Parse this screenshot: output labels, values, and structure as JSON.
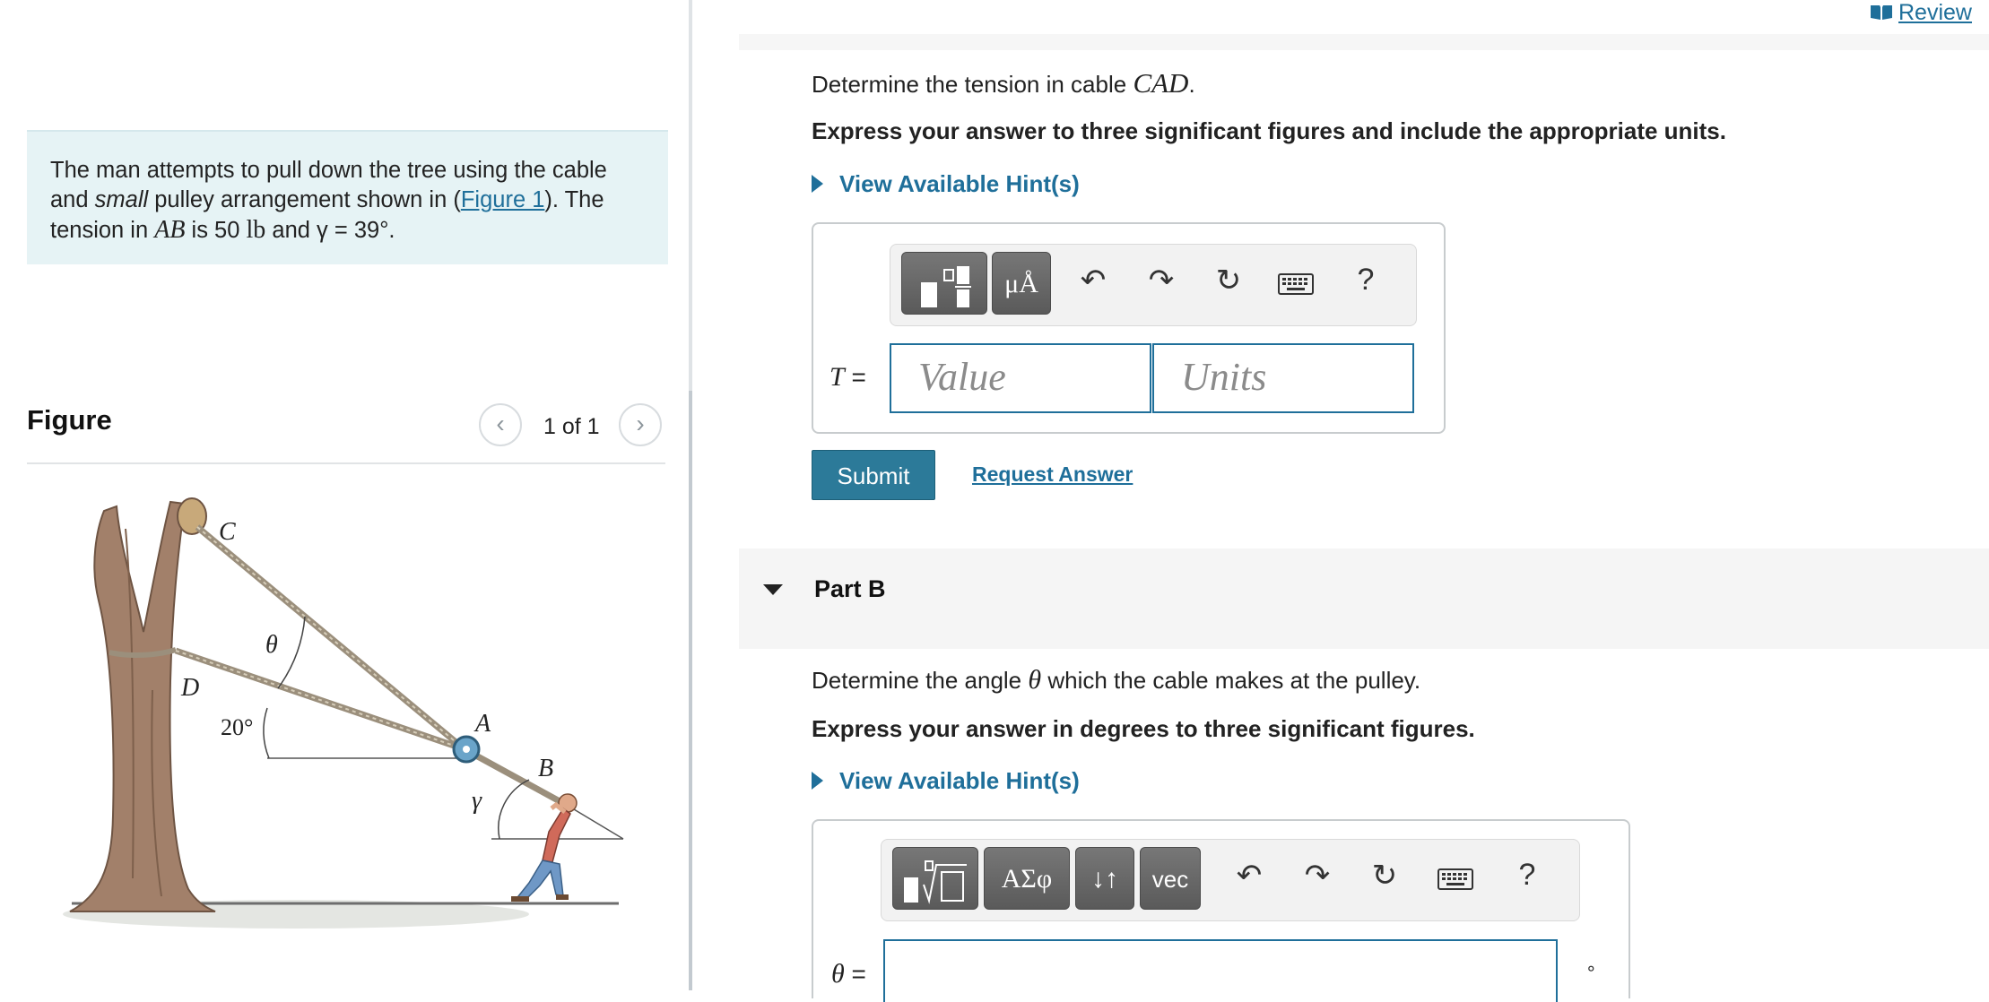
{
  "intro": {
    "t1": "The man attempts to pull down the tree using the cable and ",
    "t2": "small",
    "t3": " pulley arrangement shown in (",
    "link": "Figure 1",
    "t4": "). The tension in ",
    "ab": "AB",
    "t5": " is 50 ",
    "lb": "lb",
    "t6": " and ",
    "gamma": "γ = 39°."
  },
  "figure": {
    "title": "Figure",
    "pager": "1 of 1",
    "prev_icon": "chevron-left-icon",
    "next_icon": "chevron-right-icon",
    "labels": {
      "C": "C",
      "D": "D",
      "A": "A",
      "B": "B",
      "theta": "θ",
      "gamma": "γ",
      "angle": "20°"
    }
  },
  "header": {
    "review": "Review",
    "review_icon": "book-icon"
  },
  "partA": {
    "question_pre": "Determine the tension in cable ",
    "question_var": "CAD",
    "question_post": ".",
    "instruction": "Express your answer to three significant figures and include the appropriate units.",
    "hint": "View Available Hint(s)",
    "toolbar": {
      "templates": "templates-icon",
      "units": "μÅ",
      "undo": "undo-icon",
      "redo": "redo-icon",
      "reset": "reset-icon",
      "keyboard": "keyboard-icon",
      "help": "?"
    },
    "var_label": "T",
    "equals": " =",
    "value_placeholder": "Value",
    "units_placeholder": "Units",
    "submit": "Submit",
    "request": "Request Answer"
  },
  "partB": {
    "title": "Part B",
    "question_pre": "Determine the angle ",
    "question_var": "θ",
    "question_post": " which the cable makes at the pulley.",
    "instruction": "Express your answer in degrees to three significant figures.",
    "hint": "View Available Hint(s)",
    "toolbar": {
      "templates": "templates-root-icon",
      "greek": "ΑΣφ",
      "arrows": "↓↑",
      "vec": "vec",
      "undo": "undo-icon",
      "redo": "redo-icon",
      "reset": "reset-icon",
      "keyboard": "keyboard-icon",
      "help": "?"
    },
    "var_label": "θ",
    "equals": " =",
    "unit_suffix": "∘"
  }
}
